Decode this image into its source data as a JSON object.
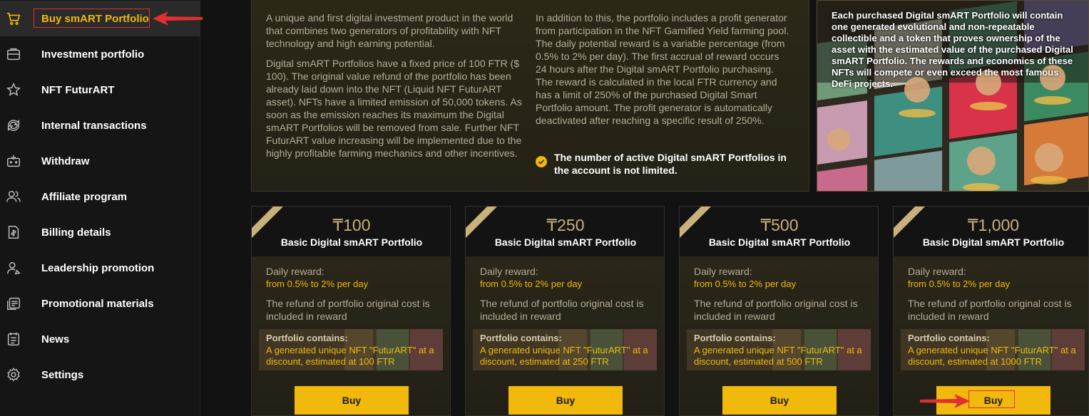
{
  "sidebar": {
    "items": [
      {
        "label": "Buy smART Portfolio",
        "icon": "cart-icon"
      },
      {
        "label": "Investment portfolio",
        "icon": "briefcase-icon"
      },
      {
        "label": "NFT FuturART",
        "icon": "star-icon"
      },
      {
        "label": "Internal transactions",
        "icon": "refresh-icon"
      },
      {
        "label": "Withdraw",
        "icon": "wallet-icon"
      },
      {
        "label": "Affiliate program",
        "icon": "users-icon"
      },
      {
        "label": "Billing details",
        "icon": "invoice-icon"
      },
      {
        "label": "Leadership promotion",
        "icon": "leader-icon"
      },
      {
        "label": "Promotional materials",
        "icon": "materials-icon"
      },
      {
        "label": "News",
        "icon": "news-icon"
      },
      {
        "label": "Settings",
        "icon": "gear-icon"
      }
    ]
  },
  "info": {
    "left_p1": "A unique and first digital investment product in the world that combines two generators of profitability with NFT technology and high earning potential.",
    "left_p2": "Digital smART Portfolios have a fixed price of 100 FTR ($ 100). The original value refund of the portfolio has been already laid down into the NFT (Liquid NFT FuturART asset). NFTs have a limited emission of 50,000 tokens. As soon as the emission reaches its maximum the Digital smART Portfolios will be removed from sale. Further NFT FuturART value increasing will be implemented due to the highly profitable farming mechanics and other incentives.",
    "right_p1": "In addition to this, the portfolio includes a profit generator from participation in the NFT Gamified Yield farming pool. The daily potential reward is a variable percentage (from 0.5% to 2% per day). The first accrual of reward occurs 24 hours after the Digital smART Portfolio purchasing. The reward is calculated in the local FTR currency and has a limit of 250% of the purchased Digital Smart Portfolio amount. The profit generator is automatically deactivated after reaching a specific result of 250%.",
    "check_text": "The number of active Digital smART Portfolios in the account is not limited."
  },
  "nft": {
    "text": "Each purchased Digital smART Portfolio will contain one generated evolutional and non-repeatable collectible and a token that proves ownership of the asset with the estimated value of the purchased Digital smART Portfolio. The rewards and economics of these NFTs will compete or even exceed the most famous DeFi projects."
  },
  "cards": [
    {
      "price": "₸100",
      "title": "Basic Digital smART Portfolio",
      "reward_label": "Daily reward:",
      "reward_value": "from 0.5% to 2% per day",
      "refund": "The refund of portfolio original cost is included in reward",
      "contains_label": "Portfolio contains:",
      "contains_text": "A generated unique NFT \"FuturART\" at a discount, estimated at 100 FTR",
      "buy": "Buy"
    },
    {
      "price": "₸250",
      "title": "Basic Digital smART Portfolio",
      "reward_label": "Daily reward:",
      "reward_value": "from 0.5% to 2% per day",
      "refund": "The refund of portfolio original cost is included in reward",
      "contains_label": "Portfolio contains:",
      "contains_text": "A generated unique NFT \"FuturART\" at a discount, estimated at 250 FTR",
      "buy": "Buy"
    },
    {
      "price": "₸500",
      "title": "Basic Digital smART Portfolio",
      "reward_label": "Daily reward:",
      "reward_value": "from 0.5% to 2% per day",
      "refund": "The refund of portfolio original cost is included in reward",
      "contains_label": "Portfolio contains:",
      "contains_text": "A generated unique NFT \"FuturART\" at a discount, estimated at 500 FTR",
      "buy": "Buy"
    },
    {
      "price": "₸1,000",
      "title": "Basic Digital smART Portfolio",
      "reward_label": "Daily reward:",
      "reward_value": "from 0.5% to 2% per day",
      "refund": "The refund of portfolio original cost is included in reward",
      "contains_label": "Portfolio contains:",
      "contains_text": "A generated unique NFT \"FuturART\" at a discount, estimated at 1000 FTR",
      "buy": "Buy"
    }
  ],
  "colors": {
    "accent": "#f0b90b",
    "gold": "#c8b17b",
    "highlight": "#e03030"
  }
}
